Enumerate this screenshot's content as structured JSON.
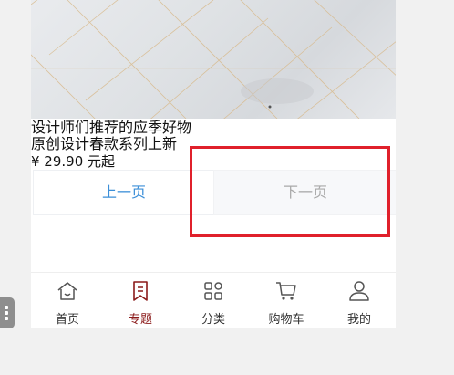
{
  "product": {
    "title_line1": "设计师们推荐的应季好物",
    "title_line2": "原创设计春款系列上新",
    "price": "¥ 29.90 元起"
  },
  "pager": {
    "prev_label": "上一页",
    "next_label": "下一页"
  },
  "tabbar": {
    "items": [
      {
        "label": "首页",
        "icon": "home-icon"
      },
      {
        "label": "专题",
        "icon": "bookmark-icon",
        "active": true
      },
      {
        "label": "分类",
        "icon": "grid-icon"
      },
      {
        "label": "购物车",
        "icon": "cart-icon"
      },
      {
        "label": "我的",
        "icon": "user-icon"
      }
    ]
  },
  "colors": {
    "accent": "#3c8fd8",
    "active_tab": "#8b1a1a",
    "highlight": "#e0202b"
  }
}
